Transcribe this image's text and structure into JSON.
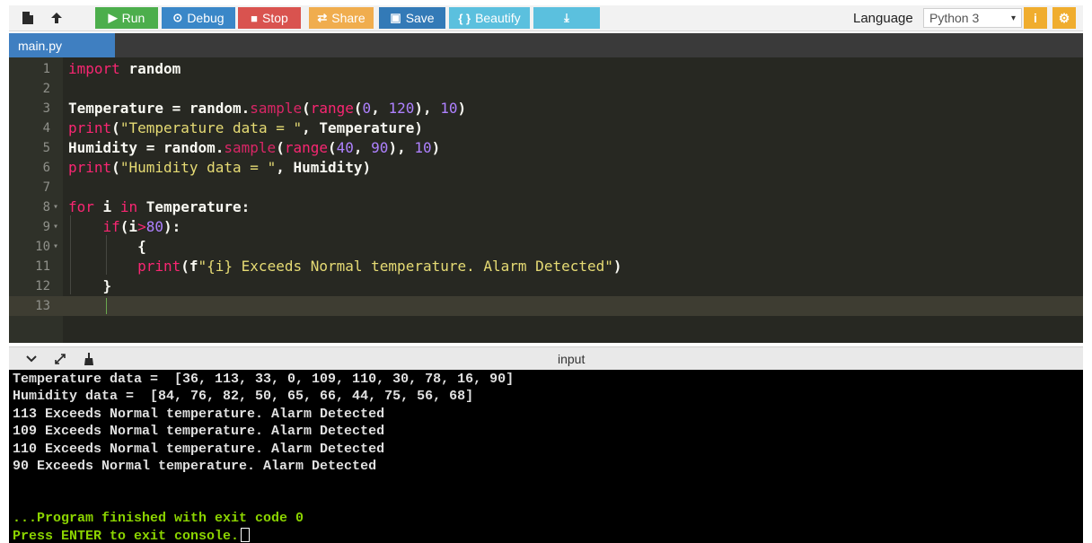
{
  "toolbar": {
    "new_file_icon": "file-icon",
    "upload_icon": "upload-icon",
    "buttons": [
      {
        "label": "Run",
        "glyph": "▶",
        "color": "#4cae4c"
      },
      {
        "label": "Debug",
        "glyph": "⊙",
        "color": "#3a87c8"
      },
      {
        "label": "Stop",
        "glyph": "■",
        "color": "#d9534f"
      },
      {
        "label": "Share",
        "glyph": "⇄",
        "color": "#f0ad4e"
      },
      {
        "label": "Save",
        "glyph": "▣",
        "color": "#337ab7"
      },
      {
        "label": "Beautify",
        "glyph": "{ }",
        "color": "#5bc0de"
      },
      {
        "label": "",
        "glyph": "⤓",
        "color": "#5bc0de"
      }
    ],
    "language_label": "Language",
    "language_value": "Python 3",
    "info_icon": "info-icon",
    "settings_icon": "gear-icon"
  },
  "tabs": [
    {
      "label": "main.py"
    }
  ],
  "editor": {
    "lines": [
      {
        "n": "1",
        "fold": ""
      },
      {
        "n": "2",
        "fold": ""
      },
      {
        "n": "3",
        "fold": ""
      },
      {
        "n": "4",
        "fold": ""
      },
      {
        "n": "5",
        "fold": ""
      },
      {
        "n": "6",
        "fold": ""
      },
      {
        "n": "7",
        "fold": ""
      },
      {
        "n": "8",
        "fold": "▾"
      },
      {
        "n": "9",
        "fold": "▾"
      },
      {
        "n": "10",
        "fold": "▾"
      },
      {
        "n": "11",
        "fold": ""
      },
      {
        "n": "12",
        "fold": ""
      },
      {
        "n": "13",
        "fold": ""
      }
    ],
    "code": {
      "l1": [
        "import",
        " random"
      ],
      "l3": [
        "Temperature = random.",
        "sample",
        "(",
        "range",
        "(",
        "0",
        ", ",
        "120",
        "), ",
        "10",
        ")"
      ],
      "l4": [
        "print",
        "(",
        "\"Temperature data = \"",
        ", Temperature)"
      ],
      "l5": [
        "Humidity = random.",
        "sample",
        "(",
        "range",
        "(",
        "40",
        ", ",
        "90",
        "), ",
        "10",
        ")"
      ],
      "l6": [
        "print",
        "(",
        "\"Humidity data = \"",
        ", Humidity)"
      ],
      "l8": [
        "for",
        " i ",
        "in",
        " Temperature:"
      ],
      "l9": [
        "    ",
        "if",
        "(i",
        ">",
        "80",
        "):"
      ],
      "l10": [
        "        {"
      ],
      "l11": [
        "        ",
        "print",
        "(f",
        "\"{i} Exceeds Normal temperature. Alarm Detected\"",
        ")"
      ],
      "l12": [
        "    }"
      ]
    },
    "active_line": "13"
  },
  "console_toolbar": {
    "collapse_icon": "chevron-down-icon",
    "expand_icon": "expand-icon",
    "clear_icon": "broom-icon",
    "input_label": "input"
  },
  "console": {
    "output": [
      "Temperature data =  [36, 113, 33, 0, 109, 110, 30, 78, 16, 90]",
      "Humidity data =  [84, 76, 82, 50, 65, 66, 44, 75, 56, 68]",
      "113 Exceeds Normal temperature. Alarm Detected",
      "109 Exceeds Normal temperature. Alarm Detected",
      "110 Exceeds Normal temperature. Alarm Detected",
      "90 Exceeds Normal temperature. Alarm Detected"
    ],
    "finished": "...Program finished with exit code 0",
    "prompt": "Press ENTER to exit console."
  }
}
